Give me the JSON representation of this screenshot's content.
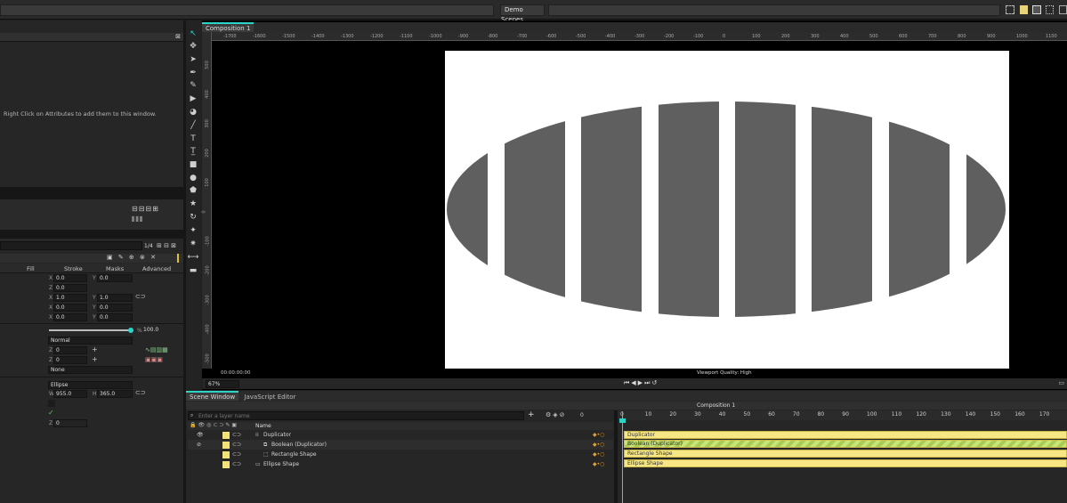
{
  "top": {
    "demo_label": "Demo Scenes"
  },
  "left": {
    "hint": "Right Click on Attributes to add them to this window.",
    "page_count": "1/4",
    "tabs": {
      "fill": "Fill",
      "stroke": "Stroke",
      "masks": "Masks",
      "advanced": "Advanced"
    },
    "fields": {
      "x1": "0.0",
      "y1": "0.0",
      "z1": "0.0",
      "x2": "1.0",
      "y2": "1.0",
      "x3": "0.0",
      "y3": "0.0",
      "x4": "0.0",
      "y4": "0.0",
      "opacity": "100.0",
      "blend": "Normal",
      "z5": "0",
      "z6": "0",
      "none": "None",
      "shape": "Ellipse",
      "w": "955.0",
      "h": "365.0",
      "last": "0"
    },
    "letters": {
      "x": "X",
      "y": "Y",
      "z": "Z",
      "w": "W",
      "h": "H",
      "pct": "%"
    }
  },
  "viewport": {
    "comp_tab": "Composition 1",
    "timecode": "00:00:00:00",
    "quality": "Viewport Quality: High",
    "zoom": "67%",
    "ruler": [
      "-1700",
      "-1600",
      "-1500",
      "-1400",
      "-1300",
      "-1200",
      "-1100",
      "-1000",
      "-900",
      "-800",
      "-700",
      "-600",
      "-500",
      "-400",
      "-300",
      "-200",
      "-100",
      "0",
      "100",
      "200",
      "300",
      "400",
      "500",
      "600",
      "700",
      "800",
      "900",
      "1000",
      "1100"
    ],
    "vruler": [
      "500",
      "400",
      "300",
      "200",
      "100",
      "0",
      "-100",
      "-200",
      "-300",
      "-400",
      "-500"
    ]
  },
  "timeline": {
    "tabs": {
      "scene": "Scene Window",
      "js": "JavaScript Editor"
    },
    "search_placeholder": "Enter a layer name",
    "count": "0",
    "name_header": "Name",
    "comp_label": "Composition 1",
    "frames": [
      "0",
      "10",
      "20",
      "30",
      "40",
      "50",
      "60",
      "70",
      "80",
      "90",
      "100",
      "110",
      "120",
      "130",
      "140",
      "150",
      "160",
      "170"
    ],
    "layers": [
      {
        "name": "Duplicator"
      },
      {
        "name": "Boolean (Duplicator)"
      },
      {
        "name": "Rectangle Shape"
      },
      {
        "name": "Ellipse Shape"
      }
    ]
  },
  "chart_data": null
}
